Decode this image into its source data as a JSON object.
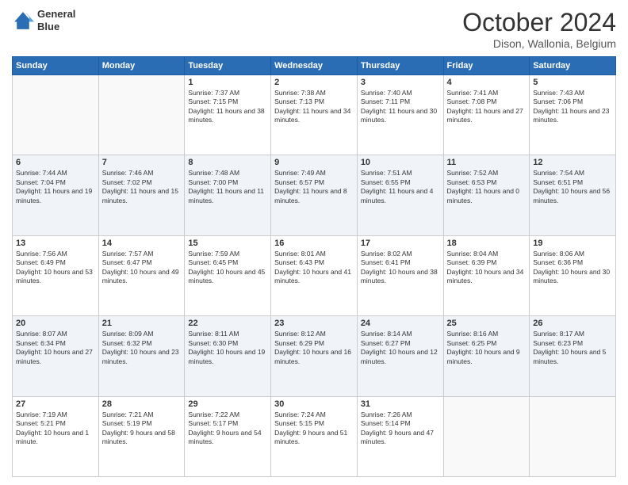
{
  "header": {
    "logo_line1": "General",
    "logo_line2": "Blue",
    "month": "October 2024",
    "location": "Dison, Wallonia, Belgium"
  },
  "days_of_week": [
    "Sunday",
    "Monday",
    "Tuesday",
    "Wednesday",
    "Thursday",
    "Friday",
    "Saturday"
  ],
  "weeks": [
    [
      {
        "day": "",
        "sunrise": "",
        "sunset": "",
        "daylight": ""
      },
      {
        "day": "",
        "sunrise": "",
        "sunset": "",
        "daylight": ""
      },
      {
        "day": "1",
        "sunrise": "Sunrise: 7:37 AM",
        "sunset": "Sunset: 7:15 PM",
        "daylight": "Daylight: 11 hours and 38 minutes."
      },
      {
        "day": "2",
        "sunrise": "Sunrise: 7:38 AM",
        "sunset": "Sunset: 7:13 PM",
        "daylight": "Daylight: 11 hours and 34 minutes."
      },
      {
        "day": "3",
        "sunrise": "Sunrise: 7:40 AM",
        "sunset": "Sunset: 7:11 PM",
        "daylight": "Daylight: 11 hours and 30 minutes."
      },
      {
        "day": "4",
        "sunrise": "Sunrise: 7:41 AM",
        "sunset": "Sunset: 7:08 PM",
        "daylight": "Daylight: 11 hours and 27 minutes."
      },
      {
        "day": "5",
        "sunrise": "Sunrise: 7:43 AM",
        "sunset": "Sunset: 7:06 PM",
        "daylight": "Daylight: 11 hours and 23 minutes."
      }
    ],
    [
      {
        "day": "6",
        "sunrise": "Sunrise: 7:44 AM",
        "sunset": "Sunset: 7:04 PM",
        "daylight": "Daylight: 11 hours and 19 minutes."
      },
      {
        "day": "7",
        "sunrise": "Sunrise: 7:46 AM",
        "sunset": "Sunset: 7:02 PM",
        "daylight": "Daylight: 11 hours and 15 minutes."
      },
      {
        "day": "8",
        "sunrise": "Sunrise: 7:48 AM",
        "sunset": "Sunset: 7:00 PM",
        "daylight": "Daylight: 11 hours and 11 minutes."
      },
      {
        "day": "9",
        "sunrise": "Sunrise: 7:49 AM",
        "sunset": "Sunset: 6:57 PM",
        "daylight": "Daylight: 11 hours and 8 minutes."
      },
      {
        "day": "10",
        "sunrise": "Sunrise: 7:51 AM",
        "sunset": "Sunset: 6:55 PM",
        "daylight": "Daylight: 11 hours and 4 minutes."
      },
      {
        "day": "11",
        "sunrise": "Sunrise: 7:52 AM",
        "sunset": "Sunset: 6:53 PM",
        "daylight": "Daylight: 11 hours and 0 minutes."
      },
      {
        "day": "12",
        "sunrise": "Sunrise: 7:54 AM",
        "sunset": "Sunset: 6:51 PM",
        "daylight": "Daylight: 10 hours and 56 minutes."
      }
    ],
    [
      {
        "day": "13",
        "sunrise": "Sunrise: 7:56 AM",
        "sunset": "Sunset: 6:49 PM",
        "daylight": "Daylight: 10 hours and 53 minutes."
      },
      {
        "day": "14",
        "sunrise": "Sunrise: 7:57 AM",
        "sunset": "Sunset: 6:47 PM",
        "daylight": "Daylight: 10 hours and 49 minutes."
      },
      {
        "day": "15",
        "sunrise": "Sunrise: 7:59 AM",
        "sunset": "Sunset: 6:45 PM",
        "daylight": "Daylight: 10 hours and 45 minutes."
      },
      {
        "day": "16",
        "sunrise": "Sunrise: 8:01 AM",
        "sunset": "Sunset: 6:43 PM",
        "daylight": "Daylight: 10 hours and 41 minutes."
      },
      {
        "day": "17",
        "sunrise": "Sunrise: 8:02 AM",
        "sunset": "Sunset: 6:41 PM",
        "daylight": "Daylight: 10 hours and 38 minutes."
      },
      {
        "day": "18",
        "sunrise": "Sunrise: 8:04 AM",
        "sunset": "Sunset: 6:39 PM",
        "daylight": "Daylight: 10 hours and 34 minutes."
      },
      {
        "day": "19",
        "sunrise": "Sunrise: 8:06 AM",
        "sunset": "Sunset: 6:36 PM",
        "daylight": "Daylight: 10 hours and 30 minutes."
      }
    ],
    [
      {
        "day": "20",
        "sunrise": "Sunrise: 8:07 AM",
        "sunset": "Sunset: 6:34 PM",
        "daylight": "Daylight: 10 hours and 27 minutes."
      },
      {
        "day": "21",
        "sunrise": "Sunrise: 8:09 AM",
        "sunset": "Sunset: 6:32 PM",
        "daylight": "Daylight: 10 hours and 23 minutes."
      },
      {
        "day": "22",
        "sunrise": "Sunrise: 8:11 AM",
        "sunset": "Sunset: 6:30 PM",
        "daylight": "Daylight: 10 hours and 19 minutes."
      },
      {
        "day": "23",
        "sunrise": "Sunrise: 8:12 AM",
        "sunset": "Sunset: 6:29 PM",
        "daylight": "Daylight: 10 hours and 16 minutes."
      },
      {
        "day": "24",
        "sunrise": "Sunrise: 8:14 AM",
        "sunset": "Sunset: 6:27 PM",
        "daylight": "Daylight: 10 hours and 12 minutes."
      },
      {
        "day": "25",
        "sunrise": "Sunrise: 8:16 AM",
        "sunset": "Sunset: 6:25 PM",
        "daylight": "Daylight: 10 hours and 9 minutes."
      },
      {
        "day": "26",
        "sunrise": "Sunrise: 8:17 AM",
        "sunset": "Sunset: 6:23 PM",
        "daylight": "Daylight: 10 hours and 5 minutes."
      }
    ],
    [
      {
        "day": "27",
        "sunrise": "Sunrise: 7:19 AM",
        "sunset": "Sunset: 5:21 PM",
        "daylight": "Daylight: 10 hours and 1 minute."
      },
      {
        "day": "28",
        "sunrise": "Sunrise: 7:21 AM",
        "sunset": "Sunset: 5:19 PM",
        "daylight": "Daylight: 9 hours and 58 minutes."
      },
      {
        "day": "29",
        "sunrise": "Sunrise: 7:22 AM",
        "sunset": "Sunset: 5:17 PM",
        "daylight": "Daylight: 9 hours and 54 minutes."
      },
      {
        "day": "30",
        "sunrise": "Sunrise: 7:24 AM",
        "sunset": "Sunset: 5:15 PM",
        "daylight": "Daylight: 9 hours and 51 minutes."
      },
      {
        "day": "31",
        "sunrise": "Sunrise: 7:26 AM",
        "sunset": "Sunset: 5:14 PM",
        "daylight": "Daylight: 9 hours and 47 minutes."
      },
      {
        "day": "",
        "sunrise": "",
        "sunset": "",
        "daylight": ""
      },
      {
        "day": "",
        "sunrise": "",
        "sunset": "",
        "daylight": ""
      }
    ]
  ]
}
